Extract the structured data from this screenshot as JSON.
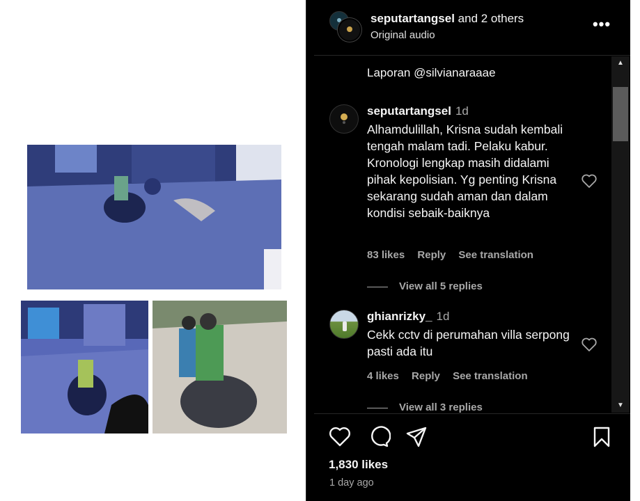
{
  "header": {
    "username": "seputartangsel",
    "and_others": "and 2 others",
    "audio": "Original audio",
    "more_icon": "ellipsis-icon"
  },
  "caption_tail": "Laporan @silvianaraaae",
  "comments": [
    {
      "user": "seputartangsel",
      "time": "1d",
      "text": "Alhamdulillah, Krisna sudah kembali tengah malam tadi. Pelaku kabur. Kronologi lengkap masih didalami pihak kepolisian. Yg penting Krisna sekarang sudah aman dan dalam kondisi sebaik-baiknya",
      "likes": "83 likes",
      "reply": "Reply",
      "translation": "See translation",
      "view_replies": "View all 5 replies"
    },
    {
      "user": "ghianrizky_",
      "time": "1d",
      "text": "Cekk cctv di perumahan villa serpong pasti ada itu",
      "likes": "4 likes",
      "reply": "Reply",
      "translation": "See translation",
      "view_replies": "View all 3 replies"
    }
  ],
  "actions": {
    "likes": "1,830 likes",
    "time_ago": "1 day ago",
    "icons": [
      "heart-icon",
      "comment-icon",
      "share-icon",
      "bookmark-icon"
    ]
  },
  "colors": {
    "background": "#000000",
    "text": "#f5f5f5",
    "secondary": "#a8a8a8",
    "divider": "#262626"
  }
}
